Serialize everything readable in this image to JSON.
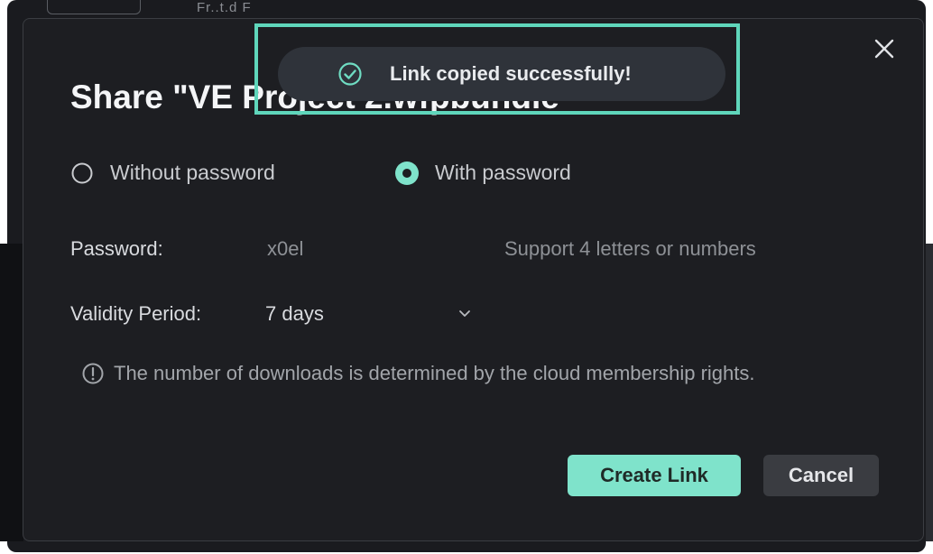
{
  "backdrop": {
    "partial_text": "Fr..t.d  F"
  },
  "dialog": {
    "title": "Share \"VE Project 2.wfpbundle\"",
    "sharing_options": [
      {
        "label": "Without password",
        "selected": false
      },
      {
        "label": "With password",
        "selected": true
      }
    ],
    "password": {
      "label": "Password:",
      "value": "x0el",
      "hint": "Support 4 letters or numbers"
    },
    "validity": {
      "label": "Validity Period:",
      "selected": "7 days"
    },
    "info_text": "The number of downloads is determined by the cloud membership rights.",
    "buttons": {
      "create": "Create Link",
      "cancel": "Cancel"
    }
  },
  "toast": {
    "message": "Link copied successfully!"
  },
  "colors": {
    "accent": "#7fe3cb",
    "dialog_bg": "#1d1e22",
    "toast_bg": "#2f333a",
    "highlight_border": "#5fd6bb"
  },
  "icons": {
    "close": "close-icon",
    "check": "check-circle-icon",
    "chevron": "chevron-down-icon",
    "info": "info-circle-icon"
  }
}
